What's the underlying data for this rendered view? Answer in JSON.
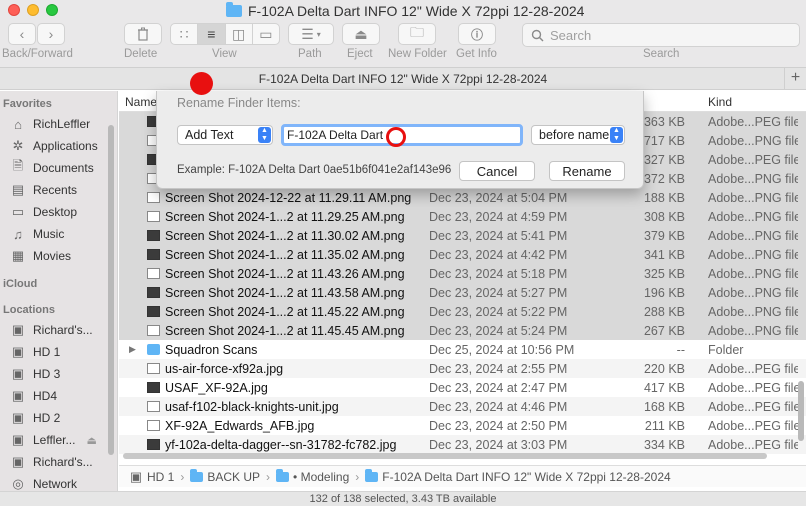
{
  "window": {
    "title": "F-102A Delta Dart INFO 12\" Wide X 72ppi 12-28-2024"
  },
  "toolbar": {
    "back_forward_label": "Back/Forward",
    "delete_label": "Delete",
    "view_label": "View",
    "path_label": "Path",
    "eject_label": "Eject",
    "new_folder_label": "New Folder",
    "get_info_label": "Get Info",
    "search_label": "Search",
    "search_placeholder": "Search"
  },
  "path_header": "F-102A Delta Dart INFO 12\" Wide X 72ppi 12-28-2024",
  "sidebar": {
    "favorites_heading": "Favorites",
    "favorites": [
      {
        "label": "RichLeffler",
        "icon": "home-icon"
      },
      {
        "label": "Applications",
        "icon": "applications-icon"
      },
      {
        "label": "Documents",
        "icon": "documents-icon"
      },
      {
        "label": "Recents",
        "icon": "recents-icon"
      },
      {
        "label": "Desktop",
        "icon": "desktop-icon"
      },
      {
        "label": "Music",
        "icon": "music-icon"
      },
      {
        "label": "Movies",
        "icon": "movies-icon"
      }
    ],
    "icloud_heading": "iCloud",
    "locations_heading": "Locations",
    "locations": [
      {
        "label": "Richard's...",
        "icon": "computer-icon"
      },
      {
        "label": "HD 1",
        "icon": "disk-icon"
      },
      {
        "label": "HD 3",
        "icon": "disk-icon"
      },
      {
        "label": "HD4",
        "icon": "disk-icon"
      },
      {
        "label": "HD 2",
        "icon": "disk-icon"
      },
      {
        "label": "Leffler...",
        "icon": "disk-icon"
      },
      {
        "label": "Richard's...",
        "icon": "disk-icon"
      },
      {
        "label": "Network",
        "icon": "network-icon"
      }
    ]
  },
  "columns": {
    "name": "Name",
    "kind": "Kind"
  },
  "files": [
    {
      "name": "",
      "date": "",
      "size": "363 KB",
      "kind": "Adobe...PEG file",
      "selected": true
    },
    {
      "name": "",
      "date": "",
      "size": "717 KB",
      "kind": "Adobe...PNG file",
      "selected": true
    },
    {
      "name": "",
      "date": "",
      "size": "327 KB",
      "kind": "Adobe...PEG file",
      "selected": true
    },
    {
      "name": "",
      "date": "",
      "size": "372 KB",
      "kind": "Adobe...PNG file",
      "selected": true
    },
    {
      "name": "Screen Shot 2024-12-22 at 11.29.11 AM.png",
      "date": "Dec 23, 2024 at 5:04 PM",
      "size": "188 KB",
      "kind": "Adobe...PNG file",
      "selected": true
    },
    {
      "name": "Screen Shot 2024-1...2 at 11.29.25 AM.png",
      "date": "Dec 23, 2024 at 4:59 PM",
      "size": "308 KB",
      "kind": "Adobe...PNG file",
      "selected": true
    },
    {
      "name": "Screen Shot 2024-1...2 at 11.30.02 AM.png",
      "date": "Dec 23, 2024 at 5:41 PM",
      "size": "379 KB",
      "kind": "Adobe...PNG file",
      "selected": true
    },
    {
      "name": "Screen Shot 2024-1...2 at 11.35.02 AM.png",
      "date": "Dec 23, 2024 at 4:42 PM",
      "size": "341 KB",
      "kind": "Adobe...PNG file",
      "selected": true
    },
    {
      "name": "Screen Shot 2024-1...2 at 11.43.26 AM.png",
      "date": "Dec 23, 2024 at 5:18 PM",
      "size": "325 KB",
      "kind": "Adobe...PNG file",
      "selected": true
    },
    {
      "name": "Screen Shot 2024-1...2 at 11.43.58 AM.png",
      "date": "Dec 23, 2024 at 5:27 PM",
      "size": "196 KB",
      "kind": "Adobe...PNG file",
      "selected": true
    },
    {
      "name": "Screen Shot 2024-1...2 at 11.45.22 AM.png",
      "date": "Dec 23, 2024 at 5:22 PM",
      "size": "288 KB",
      "kind": "Adobe...PNG file",
      "selected": true
    },
    {
      "name": "Screen Shot 2024-1...2 at 11.45.45 AM.png",
      "date": "Dec 23, 2024 at 5:24 PM",
      "size": "267 KB",
      "kind": "Adobe...PNG file",
      "selected": true
    },
    {
      "name": "Squadron Scans",
      "date": "Dec 25, 2024 at 10:56 PM",
      "size": "--",
      "kind": "Folder",
      "selected": false,
      "folder": true
    },
    {
      "name": "us-air-force-xf92a.jpg",
      "date": "Dec 23, 2024 at 2:55 PM",
      "size": "220 KB",
      "kind": "Adobe...PEG file",
      "selected": false
    },
    {
      "name": "USAF_XF-92A.jpg",
      "date": "Dec 23, 2024 at 2:47 PM",
      "size": "417 KB",
      "kind": "Adobe...PEG file",
      "selected": false
    },
    {
      "name": "usaf-f102-black-knights-unit.jpg",
      "date": "Dec 23, 2024 at 4:46 PM",
      "size": "168 KB",
      "kind": "Adobe...PEG file",
      "selected": false
    },
    {
      "name": "XF-92A_Edwards_AFB.jpg",
      "date": "Dec 23, 2024 at 2:50 PM",
      "size": "211 KB",
      "kind": "Adobe...PEG file",
      "selected": false
    },
    {
      "name": "yf-102a-delta-dagger--sn-31782-fc782.jpg",
      "date": "Dec 23, 2024 at 3:03 PM",
      "size": "334 KB",
      "kind": "Adobe...PEG file",
      "selected": false
    }
  ],
  "pathbar": {
    "items": [
      "HD 1",
      "BACK UP",
      "• Modeling",
      "F-102A Delta Dart INFO 12\" Wide X 72ppi 12-28-2024"
    ]
  },
  "status": "132 of 138 selected, 3.43 TB available",
  "dialog": {
    "title": "Rename Finder Items:",
    "mode": "Add Text",
    "text_value": "F-102A Delta Dart",
    "position": "before name",
    "example": "Example: F-102A Delta Dart 0ae51b6f041e2af143e96",
    "cancel_label": "Cancel",
    "rename_label": "Rename"
  },
  "colors": {
    "annotation_red": "#e81010",
    "selection_gray": "#d9d9d9",
    "accent_blue": "#3a82f7",
    "focus_ring": "#80b5fa"
  }
}
